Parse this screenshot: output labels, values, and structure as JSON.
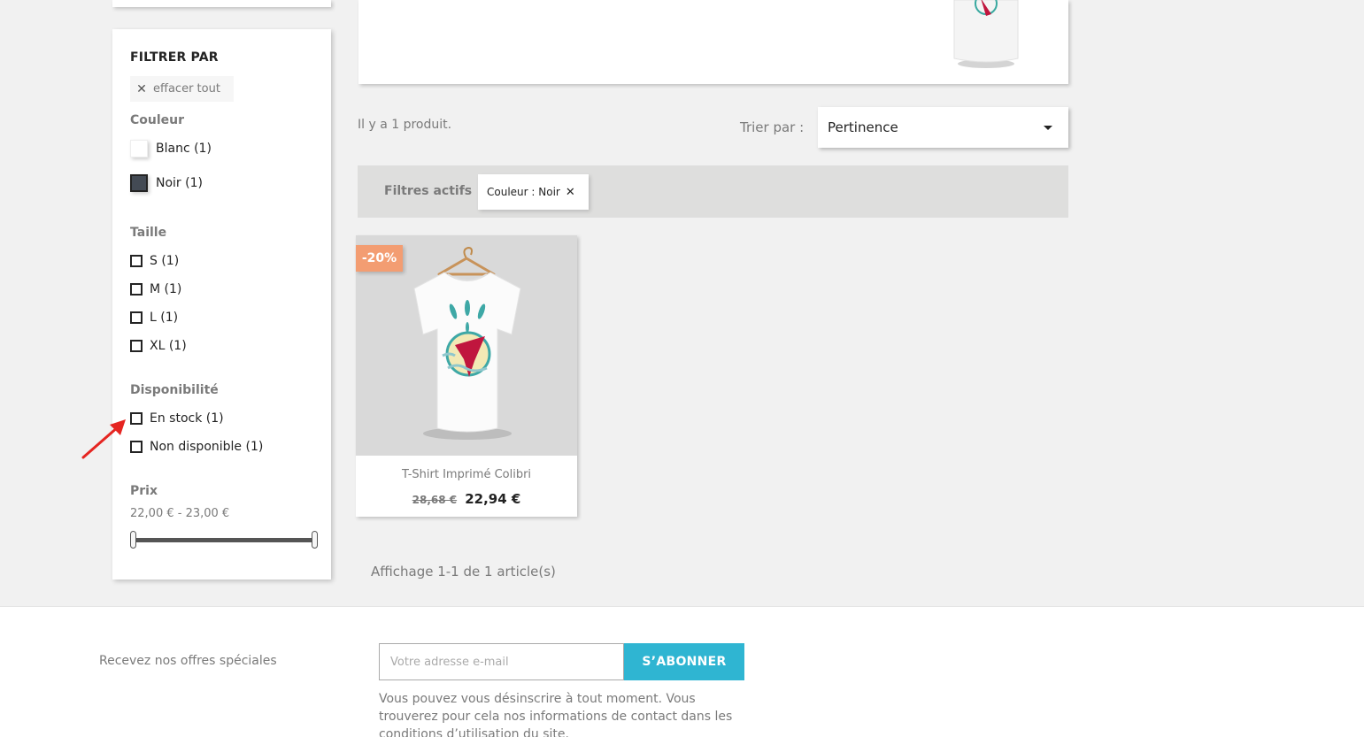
{
  "sidebar": {
    "filter_title": "FILTRER PAR",
    "clear_all_label": "effacer tout",
    "color_facet": {
      "title": "Couleur",
      "options": [
        {
          "label": "Blanc (1)",
          "swatch": "#ffffff"
        },
        {
          "label": "Noir (1)",
          "swatch": "#434a54",
          "selected": true
        }
      ]
    },
    "size_facet": {
      "title": "Taille",
      "options": [
        {
          "label": "S (1)"
        },
        {
          "label": "M (1)"
        },
        {
          "label": "L (1)"
        },
        {
          "label": "XL (1)"
        }
      ]
    },
    "availability_facet": {
      "title": "Disponibilité",
      "options": [
        {
          "label": "En stock (1)"
        },
        {
          "label": "Non disponible (1)"
        }
      ]
    },
    "price_facet": {
      "title": "Prix",
      "range_text": "22,00 € - 23,00 €",
      "min_fraction": 0,
      "max_fraction": 1
    }
  },
  "listing": {
    "count_text": "Il y a 1 produit.",
    "sort_label": "Trier par :",
    "sort_value": "Pertinence",
    "active_filters_label": "Filtres actifs",
    "active_filter_chip": "Couleur : Noir",
    "pagination_text": "Affichage 1-1 de 1 article(s)"
  },
  "product": {
    "discount_badge": "-20%",
    "name": "T-Shirt Imprimé Colibri",
    "old_price": "28,68 €",
    "new_price": "22,94 €"
  },
  "newsletter": {
    "label": "Recevez nos offres spéciales",
    "email_placeholder": "Votre adresse e-mail",
    "subscribe_label": "S’ABONNER",
    "info_text": "Vous pouvez vous désinscrire à tout moment. Vous trouverez pour cela nos informations de contact dans les conditions d’utilisation du site."
  },
  "colors": {
    "accent": "#2fb5d2",
    "discount": "#f39d72",
    "annotation_arrow": "#e52521"
  }
}
